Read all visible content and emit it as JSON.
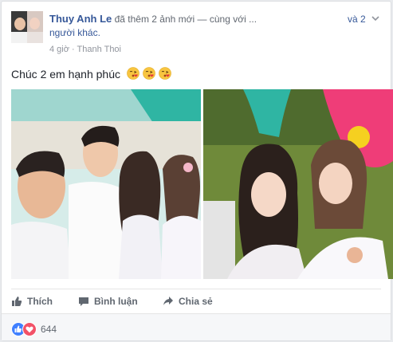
{
  "post": {
    "author": "Thuy Anh Le",
    "action_text": "đã thêm 2 ảnh mới — cùng với",
    "hidden_names": "...",
    "and_count": "và 2",
    "others_text": "người khác.",
    "time": "4 giờ",
    "separator": "·",
    "location": "Thanh Thoi",
    "chevron_icon": "chevron-down-icon",
    "text": "Chúc 2 em hạnh phúc",
    "emoji_icons": [
      "kiss-emoji-icon",
      "kiss-emoji-icon",
      "kiss-emoji-icon"
    ]
  },
  "photos": [
    {
      "name": "wedding-photo-1",
      "description_icon": "photo-icon"
    },
    {
      "name": "wedding-photo-2",
      "description_icon": "photo-icon"
    }
  ],
  "actions": {
    "like_label": "Thích",
    "comment_label": "Bình luận",
    "share_label": "Chia sẻ"
  },
  "reactions": {
    "count": "644",
    "icons": [
      "like-reaction-icon",
      "love-reaction-icon"
    ]
  },
  "colors": {
    "link_blue": "#365899",
    "like_blue": "#4080ff",
    "love_red": "#f25268",
    "muted": "#90949c"
  }
}
